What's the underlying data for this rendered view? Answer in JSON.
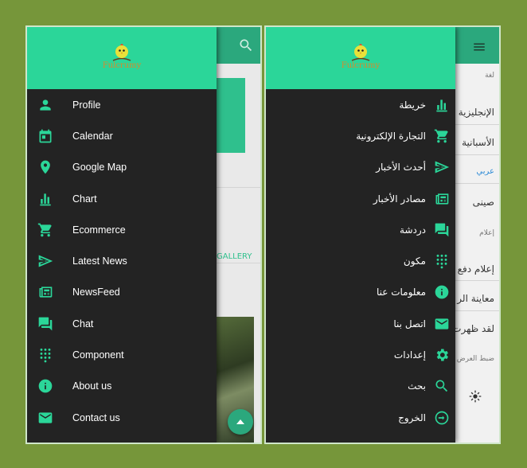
{
  "colors": {
    "background": "#76963a",
    "header": "#2bd699",
    "drawer": "#232323",
    "accent": "#2bd699",
    "appbar": "#2ba87d"
  },
  "logo": {
    "text": "Fulcrumy"
  },
  "left": {
    "menu": [
      {
        "label": "Profile",
        "icon": "person-icon"
      },
      {
        "label": "Calendar",
        "icon": "calendar-icon"
      },
      {
        "label": "Google Map",
        "icon": "map-pin-icon"
      },
      {
        "label": "Chart",
        "icon": "chart-icon"
      },
      {
        "label": "Ecommerce",
        "icon": "cart-icon"
      },
      {
        "label": "Latest News",
        "icon": "send-icon"
      },
      {
        "label": "NewsFeed",
        "icon": "newspaper-icon"
      },
      {
        "label": "Chat",
        "icon": "chat-icon"
      },
      {
        "label": "Component",
        "icon": "grid-icon"
      },
      {
        "label": "About us",
        "icon": "info-icon"
      },
      {
        "label": "Contact us",
        "icon": "mail-icon"
      }
    ],
    "background": {
      "gallery_label": "GALLERY"
    }
  },
  "right": {
    "menu": [
      {
        "label": "خريطة",
        "icon": "chart-icon"
      },
      {
        "label": "التجارة الإلكترونية",
        "icon": "cart-icon"
      },
      {
        "label": "أحدث الأخبار",
        "icon": "send-icon"
      },
      {
        "label": "مصادر الأخبار",
        "icon": "newspaper-icon"
      },
      {
        "label": "دردشة",
        "icon": "chat-icon"
      },
      {
        "label": "مكون",
        "icon": "grid-icon"
      },
      {
        "label": "معلومات عنا",
        "icon": "info-icon"
      },
      {
        "label": "اتصل بنا",
        "icon": "mail-icon"
      },
      {
        "label": "إعدادات",
        "icon": "gear-icon"
      },
      {
        "label": "بحث",
        "icon": "search-icon"
      },
      {
        "label": "الخروج",
        "icon": "logout-icon"
      }
    ],
    "background": {
      "language_header": "لغة",
      "languages": [
        "الإنجليزية",
        "الأسبانية",
        "عربي",
        "صينى"
      ],
      "notify_header": "إعلام",
      "notify_items": [
        "إعلام دفع",
        "معاينة الر",
        "لقد ظهرت"
      ],
      "display_header": "ضبط العرض"
    }
  }
}
